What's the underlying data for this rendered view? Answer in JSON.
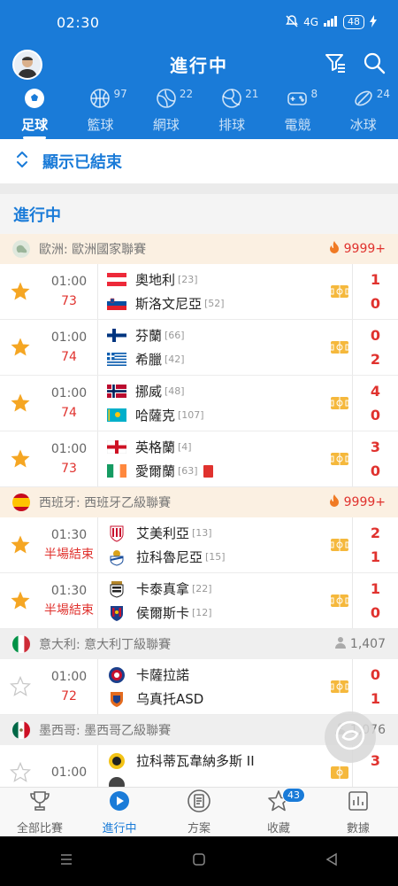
{
  "status_bar": {
    "time": "02:30",
    "network": "4G",
    "battery": "48"
  },
  "header": {
    "title": "進行中"
  },
  "sport_tabs": [
    {
      "label": "足球",
      "count": "",
      "icon": "soccer-icon",
      "active": true
    },
    {
      "label": "籃球",
      "count": "97",
      "icon": "basketball-icon"
    },
    {
      "label": "網球",
      "count": "22",
      "icon": "tennis-icon"
    },
    {
      "label": "排球",
      "count": "21",
      "icon": "volleyball-icon"
    },
    {
      "label": "電競",
      "count": "8",
      "icon": "gamepad-icon"
    },
    {
      "label": "冰球",
      "count": "24",
      "icon": "hockey-puck-icon"
    }
  ],
  "show_finished": "顯示已結束",
  "section_title": "進行中",
  "leagues": [
    {
      "name": "歐洲: 歐洲國家聯賽",
      "stat": "9999+",
      "hot": true,
      "flag": "europe",
      "matches": [
        {
          "starred": true,
          "time": "01:00",
          "status": "73",
          "home": {
            "name": "奧地利",
            "rank": "[23]",
            "flag": "austria"
          },
          "away": {
            "name": "斯洛文尼亞",
            "rank": "[52]",
            "flag": "slovenia"
          },
          "score_home": "1",
          "score_away": "0"
        },
        {
          "starred": true,
          "time": "01:00",
          "status": "74",
          "home": {
            "name": "芬蘭",
            "rank": "[66]",
            "flag": "finland"
          },
          "away": {
            "name": "希臘",
            "rank": "[42]",
            "flag": "greece"
          },
          "score_home": "0",
          "score_away": "2"
        },
        {
          "starred": true,
          "time": "01:00",
          "status": "74",
          "home": {
            "name": "挪威",
            "rank": "[48]",
            "flag": "norway"
          },
          "away": {
            "name": "哈薩克",
            "rank": "[107]",
            "flag": "kazakhstan"
          },
          "score_home": "4",
          "score_away": "0"
        },
        {
          "starred": true,
          "time": "01:00",
          "status": "73",
          "home": {
            "name": "英格蘭",
            "rank": "[4]",
            "flag": "england"
          },
          "away": {
            "name": "愛爾蘭",
            "rank": "[63]",
            "flag": "ireland",
            "red_card": true
          },
          "score_home": "3",
          "score_away": "0"
        }
      ]
    },
    {
      "name": "西班牙: 西班牙乙級聯賽",
      "stat": "9999+",
      "hot": true,
      "flag": "spain",
      "matches": [
        {
          "starred": true,
          "time": "01:30",
          "status": "半場結束",
          "home": {
            "name": "艾美利亞",
            "rank": "[13]",
            "crest": "crest-almeria"
          },
          "away": {
            "name": "拉科魯尼亞",
            "rank": "[15]",
            "crest": "crest-deportivo"
          },
          "score_home": "2",
          "score_away": "1"
        },
        {
          "starred": true,
          "time": "01:30",
          "status": "半場結束",
          "home": {
            "name": "卡泰真拿",
            "rank": "[22]",
            "crest": "crest-cartagena"
          },
          "away": {
            "name": "侯爾斯卡",
            "rank": "[12]",
            "crest": "crest-huesca"
          },
          "score_home": "1",
          "score_away": "0"
        }
      ]
    },
    {
      "name": "意大利: 意大利丁級聯賽",
      "stat": "1,407",
      "hot": false,
      "flag": "italy",
      "matches": [
        {
          "starred": false,
          "time": "01:00",
          "status": "72",
          "home": {
            "name": "卡薩拉諾",
            "rank": "",
            "crest": "crest-casarano"
          },
          "away": {
            "name": "乌真托ASD",
            "rank": "",
            "crest": "crest-ugento"
          },
          "score_home": "0",
          "score_away": "1"
        }
      ]
    },
    {
      "name": "墨西哥: 墨西哥乙級聯賽",
      "stat": "1,076",
      "hot": false,
      "flag": "mexico",
      "matches": [
        {
          "starred": false,
          "time": "01:00",
          "status": "",
          "home": {
            "name": "拉科蒂瓦韋納多斯 II",
            "rank": "",
            "crest": "crest-lacoyotes"
          },
          "away": {
            "name": "",
            "rank": "",
            "crest": "crest-generic"
          },
          "score_home": "3",
          "score_away": ""
        }
      ]
    }
  ],
  "bottom_nav": [
    {
      "label": "全部比賽",
      "icon": "trophy-icon"
    },
    {
      "label": "進行中",
      "icon": "play-circle-icon",
      "active": true
    },
    {
      "label": "方案",
      "icon": "document-icon"
    },
    {
      "label": "收藏",
      "icon": "star-icon",
      "badge": "43"
    },
    {
      "label": "數據",
      "icon": "bar-chart-icon"
    }
  ],
  "colors": {
    "primary": "#1a7bd8",
    "score_red": "#e0322e",
    "star_gold": "#f5a623"
  }
}
